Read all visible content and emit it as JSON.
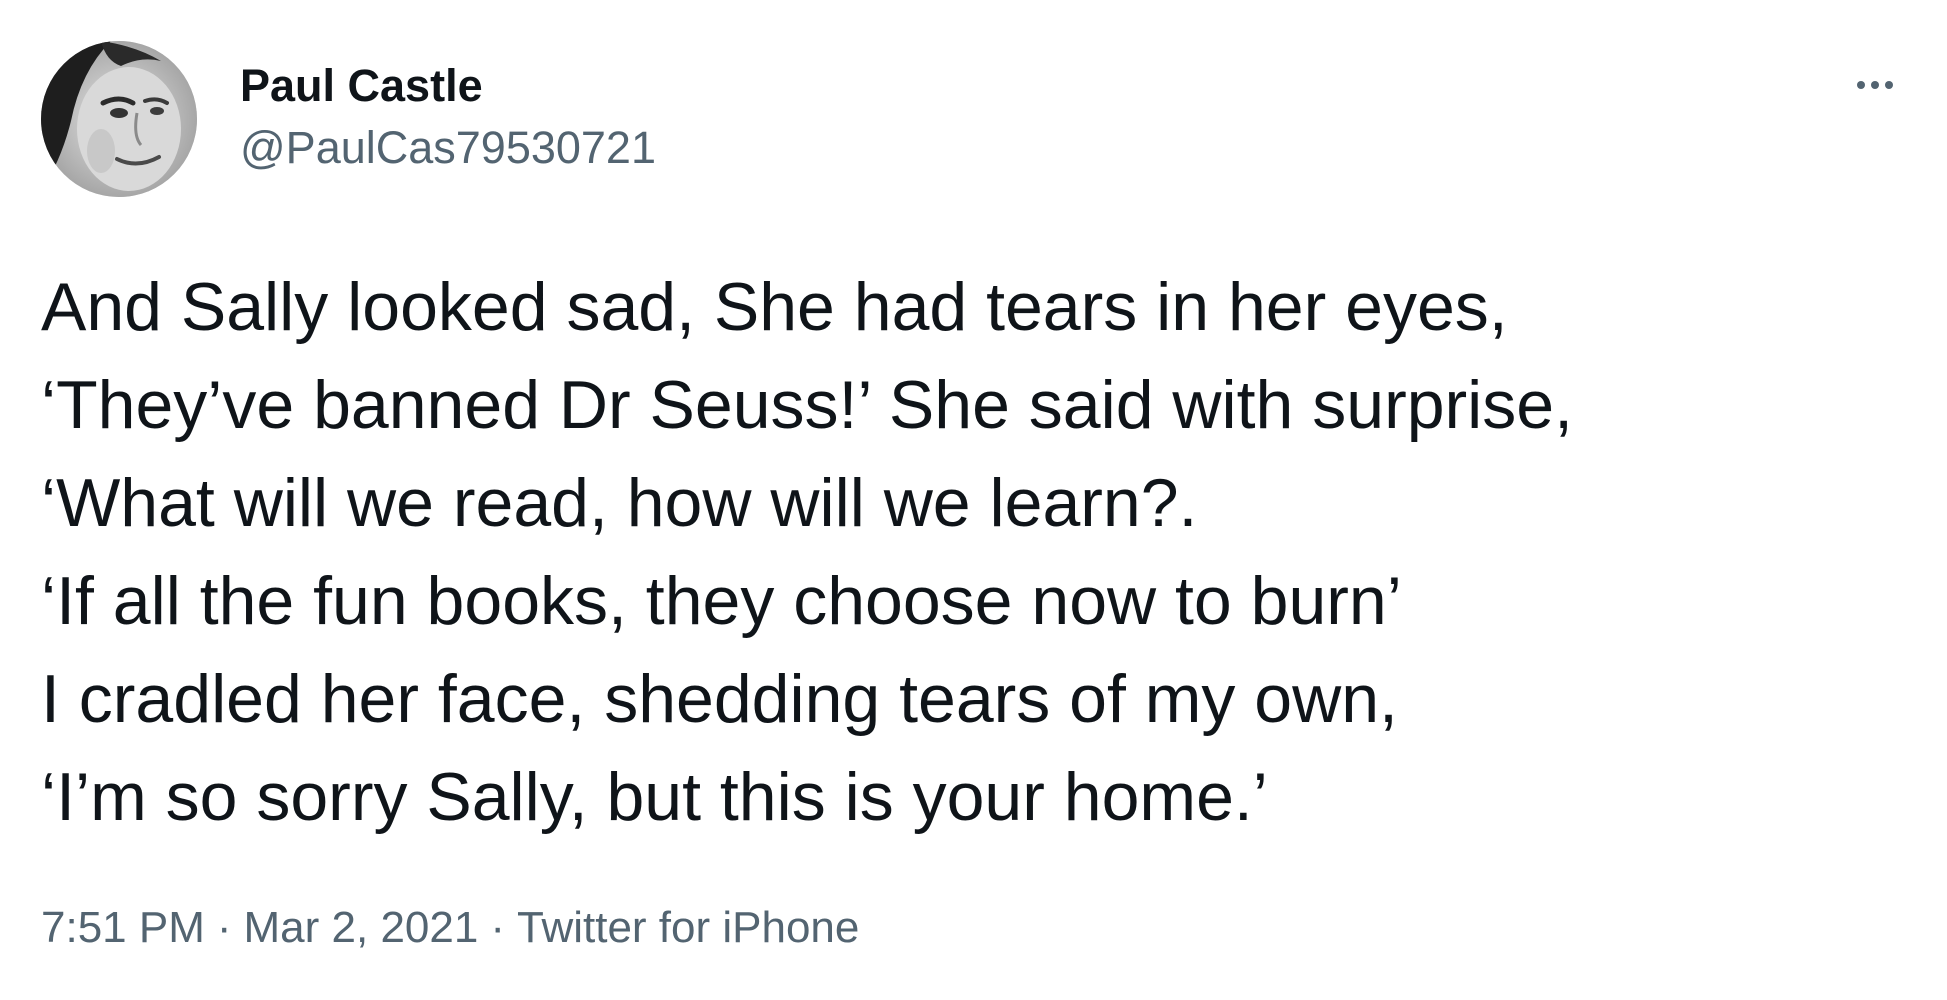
{
  "author": {
    "display_name": "Paul Castle",
    "handle": "@PaulCas79530721",
    "avatar_icon": "profile-photo-grayscale"
  },
  "menu": {
    "more_icon": "more-options-icon"
  },
  "tweet": {
    "lines": [
      "And Sally looked sad, She had tears in her eyes,",
      "‘They’ve banned Dr Seuss!’ She said with surprise,",
      "‘What will we read, how will we learn?.",
      "‘If all the fun books, they choose now to burn’",
      "I cradled her face, shedding tears of my own,",
      "‘I’m so sorry Sally, but this is your home.’"
    ]
  },
  "meta": {
    "time": "7:51 PM",
    "separator": "·",
    "date": "Mar 2, 2021",
    "source": "Twitter for iPhone"
  },
  "colors": {
    "text_primary": "#0f1419",
    "text_secondary": "#536471",
    "background": "#ffffff"
  }
}
